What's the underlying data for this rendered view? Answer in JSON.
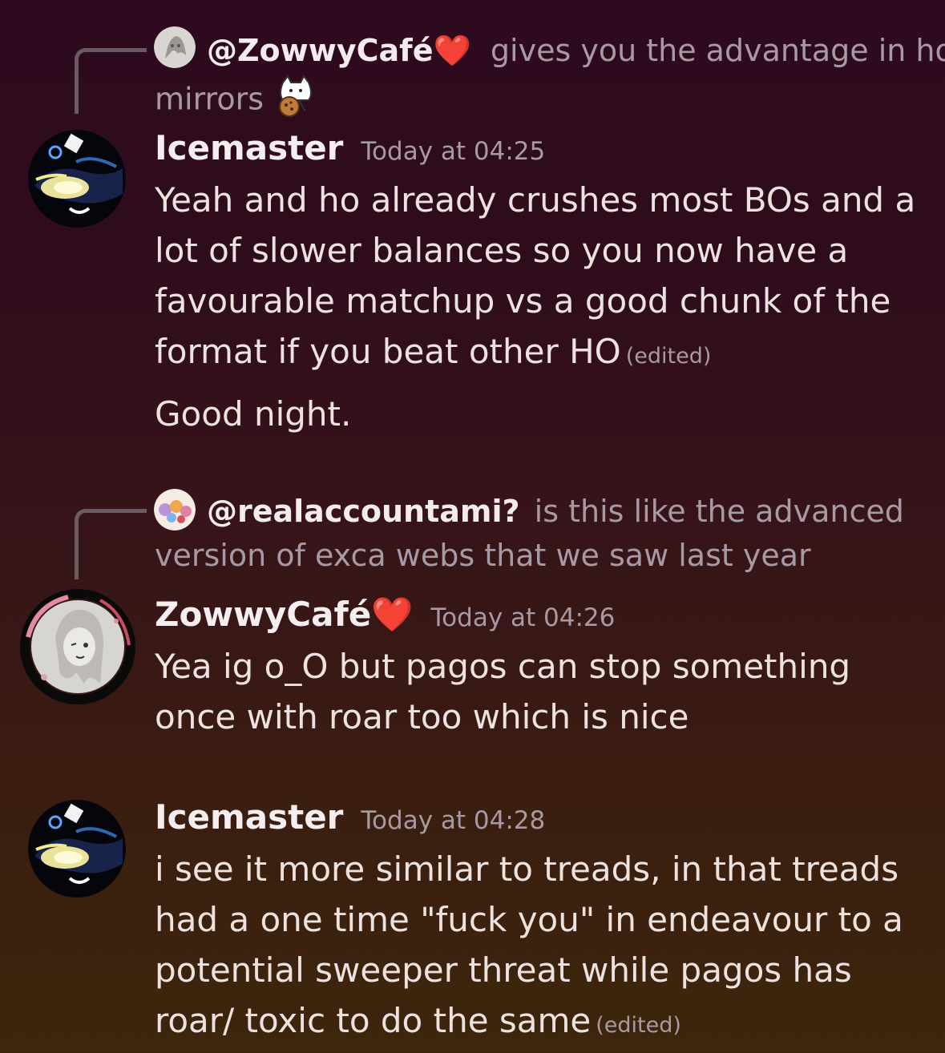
{
  "messages": [
    {
      "reply": {
        "mention": "@ZowwyCafé",
        "heart": "❤️",
        "text_first": "gives you the advantage in ho",
        "text_second": "mirrors"
      },
      "username": "Icemaster",
      "timestamp": "Today at 04:25",
      "content": "Yeah and ho already crushes most BOs and a lot of slower balances so you now have a favourable matchup vs a good chunk of the format if you beat other HO",
      "edited": "(edited)",
      "followup": "Good night."
    },
    {
      "reply": {
        "mention": "@realaccountami?",
        "text_first": "is this like the advanced",
        "text_second": "version of exca webs that we saw last year"
      },
      "username": "ZowwyCafé",
      "heart": "❤️",
      "timestamp": "Today at 04:26",
      "content": "Yea ig o_O  but pagos can stop something once with roar too which is nice"
    },
    {
      "username": "Icemaster",
      "timestamp": "Today at 04:28",
      "content": "i see it more similar to treads, in that treads had a one time \"fuck you\" in endeavour to a potential sweeper threat while pagos has roar/ toxic to do the same",
      "edited": "(edited)"
    }
  ],
  "colors": {
    "heart": "#ff1f2f",
    "muted_text": "#a89aa4",
    "body_text": "#ece2e0"
  },
  "icons": [
    "reply-connector",
    "avatar-icemaster",
    "avatar-zowwycafe",
    "avatar-realaccountami",
    "cat-cookie-emoji"
  ]
}
